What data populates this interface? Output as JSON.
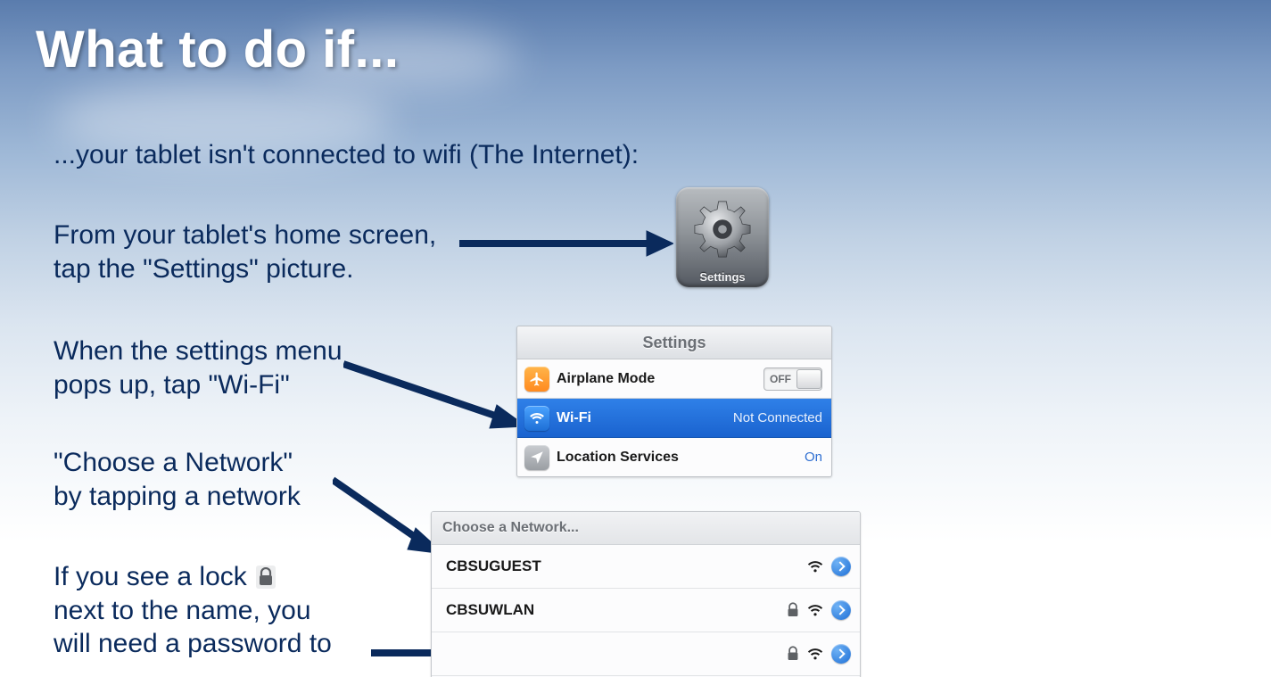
{
  "title": "What to do if...",
  "body": {
    "line1": "...your tablet isn't connected to wifi (The Internet):",
    "line2": "From your tablet's home screen,\ntap the \"Settings\" picture.",
    "line3": "When the settings menu\npops up, tap \"Wi-Fi\"",
    "line4": "\"Choose a Network\"\nby tapping a network",
    "line5a": "If you see a lock",
    "line5b": "next to the name, you\nwill need a password to"
  },
  "settingsIcon": {
    "label": "Settings"
  },
  "settingsPanel": {
    "header": "Settings",
    "rows": [
      {
        "label": "Airplane Mode",
        "value": "OFF",
        "icon": "airplane"
      },
      {
        "label": "Wi-Fi",
        "value": "Not Connected",
        "icon": "wifi",
        "selected": true
      },
      {
        "label": "Location Services",
        "value": "On",
        "icon": "location"
      }
    ]
  },
  "networkPanel": {
    "header": "Choose a Network...",
    "rows": [
      {
        "name": "CBSUGUEST",
        "locked": false
      },
      {
        "name": "CBSUWLAN",
        "locked": true
      },
      {
        "name": "",
        "locked": true
      }
    ]
  }
}
